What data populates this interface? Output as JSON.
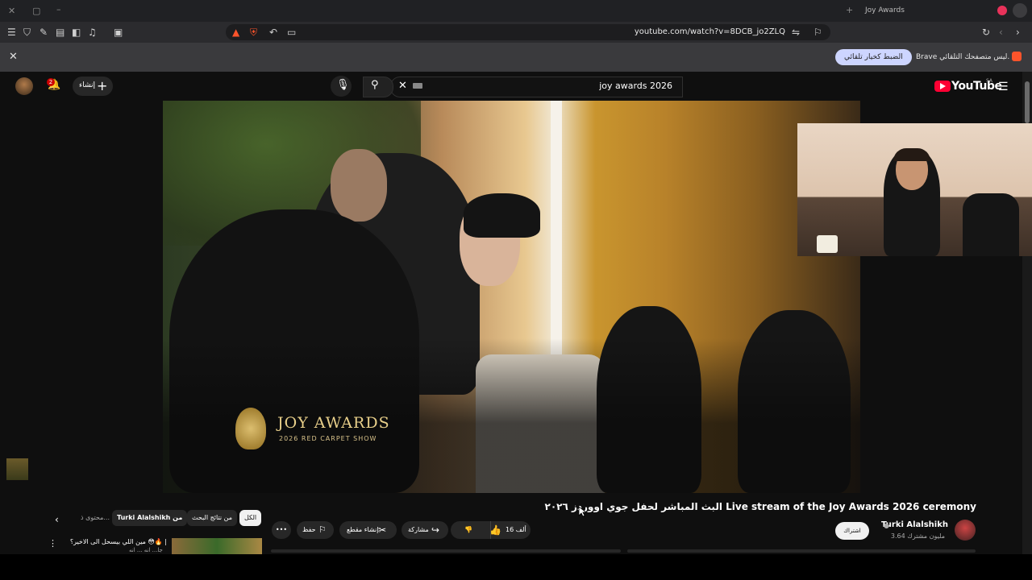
{
  "browser": {
    "tab_title": "Joy Awards",
    "url": "youtube.com/watch?v=8DCB_jo2ZLQ"
  },
  "notification": {
    "text": "Brave ليس متصفحك التلقائي.",
    "button": "الضبط كخيار تلقائي"
  },
  "youtube": {
    "logo_text": "YouTube",
    "region": "SA",
    "search_query": "joy awards 2026",
    "create_label": "إنشاء",
    "notification_count": "2"
  },
  "video": {
    "overlay_title": "JOY AWARDS",
    "overlay_subtitle": "2026 RED CARPET SHOW",
    "title": "البث المباشر لحفل جوي اووردز ٢٠٢٦ Live stream of the Joy Awards 2026 ceremony",
    "channel": "Turki Alalshikh",
    "subscribers": "3.64 مليون مشترك",
    "subscribe_label": "اشتراك",
    "like_count": "16 ألف",
    "share_label": "مشاركة",
    "clip_label": "إنشاء مقطع",
    "save_label": "حفظ"
  },
  "chips": {
    "all": "الكل",
    "search_results": "من نتائج البحث",
    "from_channel": "Turki Alalshikh من",
    "related": "محتوى ذ..."
  },
  "related": {
    "title": "مين اللي بيسحل الى الاخير؟ 😳🔥 |",
    "subtitle": "جا... انه ... انه"
  },
  "colors": {
    "youtube_red": "#ff0033",
    "bg": "#0f0f0f",
    "brave_orange": "#fb542b"
  }
}
